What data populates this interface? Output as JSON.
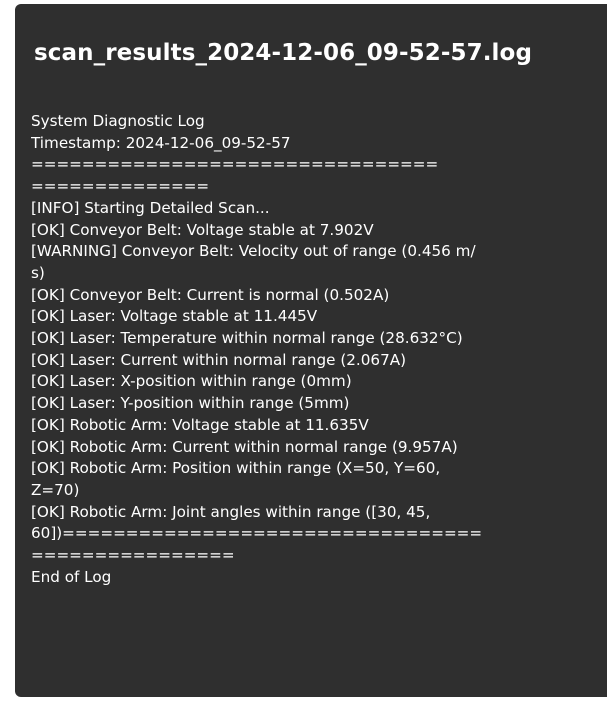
{
  "window": {
    "title": "scan_results_2024-12-06_09-52-57.log"
  },
  "log": {
    "lines": [
      "System Diagnostic Log",
      "Timestamp: 2024-12-06_09-52-57",
      "================================",
      "==============",
      "[INFO] Starting Detailed Scan...",
      "[OK] Conveyor Belt: Voltage stable at 7.902V",
      "[WARNING] Conveyor Belt: Velocity out of range (0.456 m/",
      "s)",
      "[OK] Conveyor Belt: Current is normal (0.502A)",
      "[OK] Laser: Voltage stable at 11.445V",
      "[OK] Laser: Temperature within normal range (28.632°C)",
      "[OK] Laser: Current within normal range (2.067A)",
      "[OK] Laser: X-position within range (0mm)",
      "[OK] Laser: Y-position within range (5mm)",
      "[OK] Robotic Arm: Voltage stable at 11.635V",
      "[OK] Robotic Arm: Current within normal range (9.957A)",
      "[OK] Robotic Arm: Position within range (X=50, Y=60,",
      "Z=70)",
      "[OK] Robotic Arm: Joint angles within range ([30, 45,",
      "60])=================================",
      "================",
      "End of Log"
    ]
  },
  "colors": {
    "window_background": "#2f2f2f",
    "text": "#ffffff"
  }
}
